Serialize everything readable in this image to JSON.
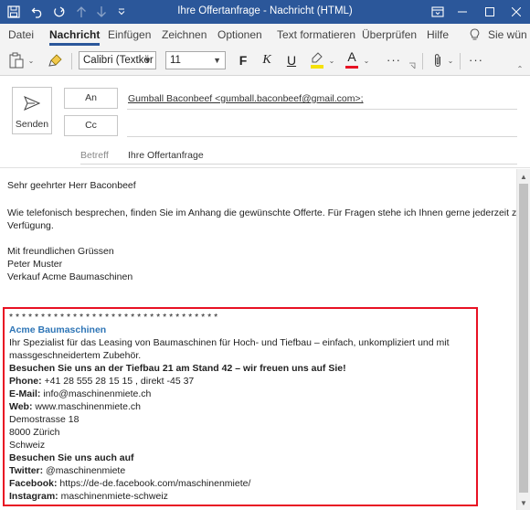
{
  "window": {
    "title": "Ihre Offertanfrage  -  Nachricht (HTML)"
  },
  "ribbon_tabs": [
    {
      "label": "Datei"
    },
    {
      "label": "Nachricht",
      "active": true
    },
    {
      "label": "Einfügen"
    },
    {
      "label": "Zeichnen"
    },
    {
      "label": "Optionen"
    },
    {
      "label": "Text formatieren"
    },
    {
      "label": "Überprüfen"
    },
    {
      "label": "Hilfe"
    },
    {
      "label": "Sie wün"
    }
  ],
  "toolbar": {
    "font_name": "Calibri (Textkör",
    "font_size": "11",
    "bold_label": "F",
    "italic_label": "K",
    "underline_label": "U",
    "font_color_label": "A",
    "more_label": "···",
    "more2_label": "···",
    "highlight_color": "#f5e10a",
    "font_color": "#e81123"
  },
  "compose": {
    "send_label": "Senden",
    "to_label": "An",
    "cc_label": "Cc",
    "to_value": "Gumball Baconbeef <gumball.baconbeef@gmail.com>;",
    "subject_label": "Betreff",
    "subject_value": "Ihre Offertanfrage"
  },
  "body": {
    "greeting": "Sehr geehrter Herr Baconbeef",
    "para1_line1": "Wie telefonisch besprechen, finden Sie im Anhang die gewünschte Offerte. Für Fragen stehe ich Ihnen gerne jederzeit zur",
    "para1_line2": "Verfügung.",
    "closing": "Mit freundlichen Grüssen",
    "name": "Peter Muster",
    "department": "Verkauf Acme Baumaschinen"
  },
  "signature": {
    "stars": "* * * * * * * * * * * * * * * * * * * * * * * * * * * * * * * * *",
    "company": "Acme Baumaschinen",
    "desc_line1": "Ihr Spezialist für das Leasing von Baumaschinen für Hoch- und Tiefbau – einfach, unkompliziert und mit",
    "desc_line2": "massgeschneidertem  Zubehör.",
    "event": "Besuchen Sie uns an der Tiefbau 21 am Stand 42 – wir freuen uns auf Sie!",
    "phone_label": "Phone:",
    "phone_value": " +41 28 555 28 15 15 , direkt -45 37",
    "email_label": "E-Mail:",
    "email_value": " info@maschinenmiete.ch",
    "web_label": "Web:",
    "web_value": " www.maschinenmiete.ch",
    "street": "Demostrasse 18",
    "city": "8000 Zürich",
    "country": "Schweiz",
    "social_heading": "Besuchen Sie uns auch auf",
    "twitter_label": "Twitter:",
    "twitter_value": " @maschinenmiete",
    "facebook_label": "Facebook:",
    "facebook_value": " https://de-de.facebook.com/maschinenmiete/",
    "instagram_label": "Instagram:",
    "instagram_value": " maschinenmiete-schweiz",
    "highlight_color": "#e81123"
  },
  "icons": {
    "accent": "#2b579a"
  }
}
